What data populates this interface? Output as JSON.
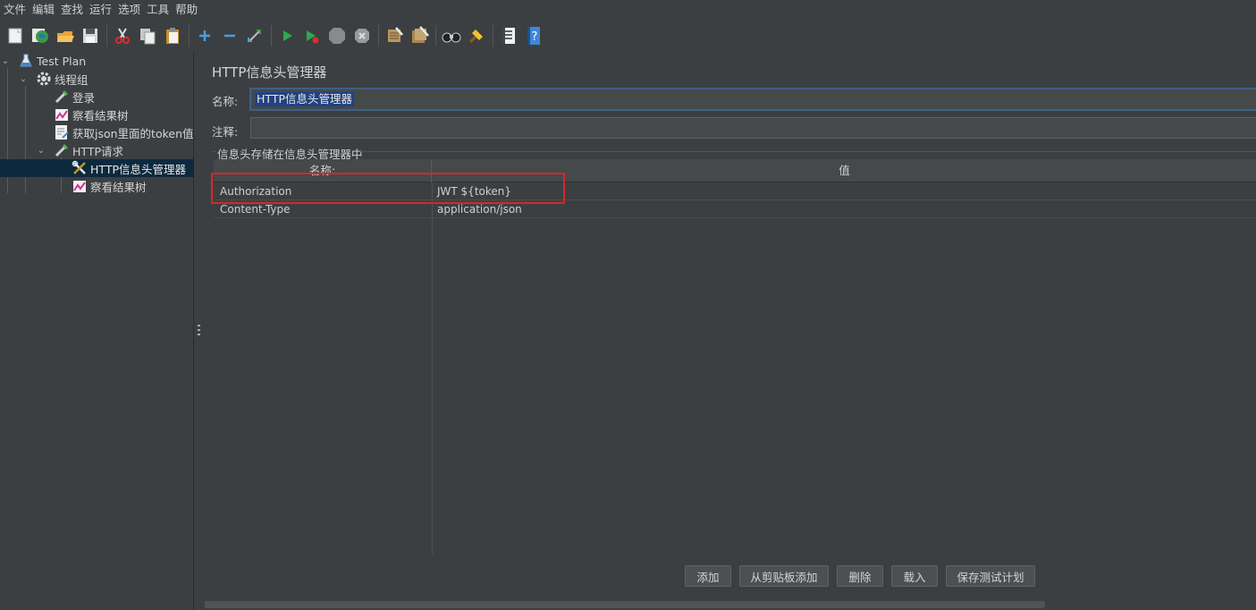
{
  "menu": [
    "文件",
    "编辑",
    "查找",
    "运行",
    "选项",
    "工具",
    "帮助"
  ],
  "toolbar": {
    "icons": [
      "new-icon",
      "templates-icon",
      "open-icon",
      "save-icon",
      "cut-icon",
      "copy-icon",
      "paste-icon",
      "expand-icon",
      "collapse-icon",
      "toggle-icon",
      "start-icon",
      "start-no-pause-icon",
      "stop-icon",
      "shutdown-icon",
      "clear-icon",
      "clear-all-icon",
      "search-icon",
      "reset-search-icon",
      "function-helper-icon",
      "help-icon"
    ]
  },
  "tree": {
    "items": [
      {
        "label": "Test Plan",
        "icon": "test-plan-icon"
      },
      {
        "label": "线程组",
        "icon": "thread-group-icon"
      },
      {
        "label": "登录",
        "icon": "sampler-icon"
      },
      {
        "label": "察看结果树",
        "icon": "listener-icon"
      },
      {
        "label": "获取json里面的token值",
        "icon": "extractor-icon"
      },
      {
        "label": "HTTP请求",
        "icon": "sampler-icon"
      },
      {
        "label": "HTTP信息头管理器",
        "icon": "config-tools-icon"
      },
      {
        "label": "察看结果树",
        "icon": "listener-icon"
      }
    ]
  },
  "panel": {
    "title": "HTTP信息头管理器",
    "name_label": "名称:",
    "name_value": "HTTP信息头管理器",
    "comment_label": "注释:",
    "comment_value": "",
    "group_title": "信息头存储在信息头管理器中"
  },
  "table": {
    "columns": [
      "名称:",
      "值"
    ],
    "rows": [
      [
        "Authorization",
        "JWT ${token}"
      ],
      [
        "Content-Type",
        "application/json"
      ]
    ]
  },
  "buttons": {
    "add": "添加",
    "add_clipboard": "从剪贴板添加",
    "delete": "删除",
    "load": "载入",
    "save_plan": "保存测试计划"
  },
  "colors": {
    "background": "#3c3f41",
    "selection": "#0d293e",
    "highlight_box": "#d6262c",
    "text_selection": "#214283"
  }
}
